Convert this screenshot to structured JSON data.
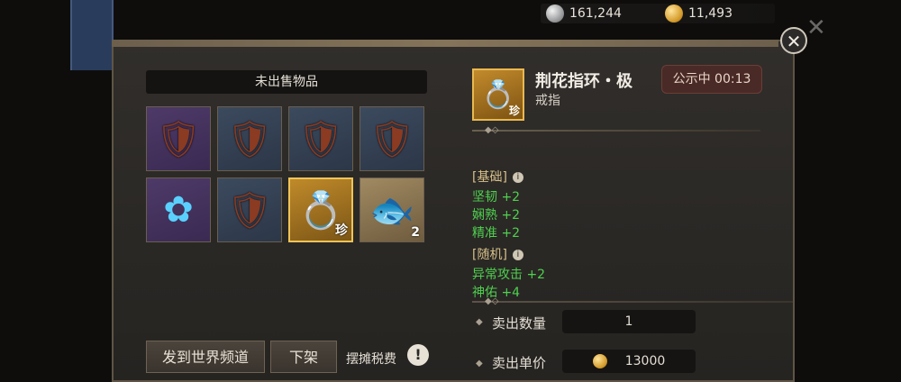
{
  "currencies": {
    "silver": "161,244",
    "gold": "11,493"
  },
  "header": {
    "close_symbol": "✕",
    "section_title": "未出售物品"
  },
  "inventory": [
    {
      "name": "armor-scroll",
      "quality": "purple",
      "badge": ""
    },
    {
      "name": "armor-scroll",
      "quality": "blue",
      "badge": ""
    },
    {
      "name": "armor-scroll",
      "quality": "blue",
      "badge": ""
    },
    {
      "name": "armor-scroll",
      "quality": "blue",
      "badge": ""
    },
    {
      "name": "blue-flower",
      "quality": "purple",
      "badge": ""
    },
    {
      "name": "armor-scroll",
      "quality": "blue",
      "badge": ""
    },
    {
      "name": "gold-ring",
      "quality": "gold",
      "badge": "珍"
    },
    {
      "name": "fish",
      "quality": "tan",
      "badge": "2"
    }
  ],
  "item": {
    "title": "荆花指环・极",
    "type": "戒指",
    "rarity_badge": "珍",
    "timer": "公示中 00:13"
  },
  "stats": {
    "basic_label": "[基础]",
    "basic": [
      "坚韧 +2",
      "娴熟 +2",
      "精准 +2"
    ],
    "random_label": "[随机]",
    "random": [
      "异常攻击 +2",
      "神佑 +4"
    ]
  },
  "sale": {
    "quantity_label": "卖出数量",
    "quantity_value": "1",
    "price_label": "卖出单价",
    "price_value": "13000"
  },
  "buttons": {
    "world_channel": "发到世界频道",
    "take_down": "下架",
    "tax_label": "摆摊税费"
  }
}
